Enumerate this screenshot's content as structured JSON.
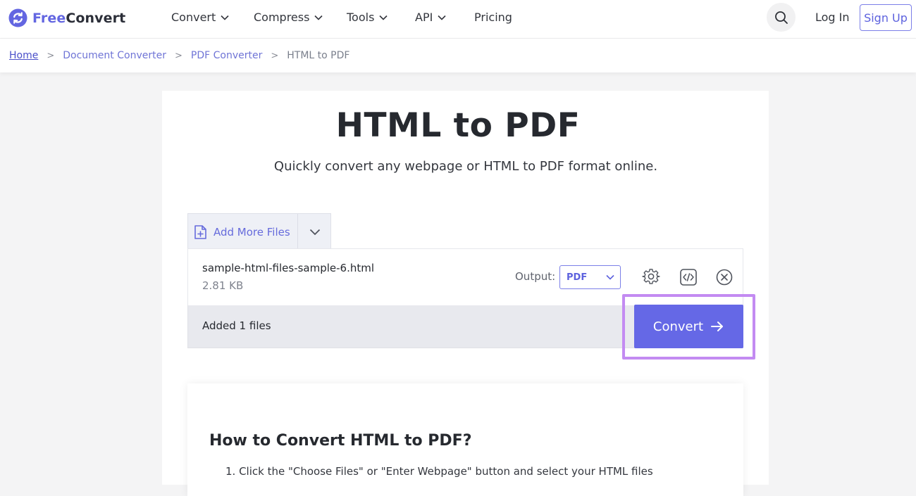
{
  "header": {
    "logo": {
      "free": "Free",
      "convert": "Convert"
    },
    "nav": [
      {
        "label": "Convert",
        "dropdown": true
      },
      {
        "label": "Compress",
        "dropdown": true
      },
      {
        "label": "Tools",
        "dropdown": true
      },
      {
        "label": "API",
        "dropdown": true
      },
      {
        "label": "Pricing",
        "dropdown": false
      }
    ],
    "login_label": "Log In",
    "signup_label": "Sign Up"
  },
  "breadcrumb": [
    {
      "label": "Home"
    },
    {
      "label": "Document Converter"
    },
    {
      "label": "PDF Converter"
    },
    {
      "label": "HTML to PDF"
    }
  ],
  "main": {
    "title": "HTML to PDF",
    "subtitle": "Quickly convert any webpage or HTML to PDF format online."
  },
  "uploader": {
    "add_more_label": "Add More Files",
    "file": {
      "name": "sample-html-files-sample-6.html",
      "size": "2.81 KB",
      "output_label": "Output:",
      "output_value": "PDF"
    },
    "added_text": "Added 1 files",
    "convert_label": "Convert"
  },
  "howto": {
    "title": "How to Convert HTML to PDF?",
    "step1": "1. Click the \"Choose Files\" or \"Enter Webpage\" button and select your HTML files"
  },
  "colors": {
    "accent": "#6568e6",
    "highlight": "#c38bf2"
  }
}
